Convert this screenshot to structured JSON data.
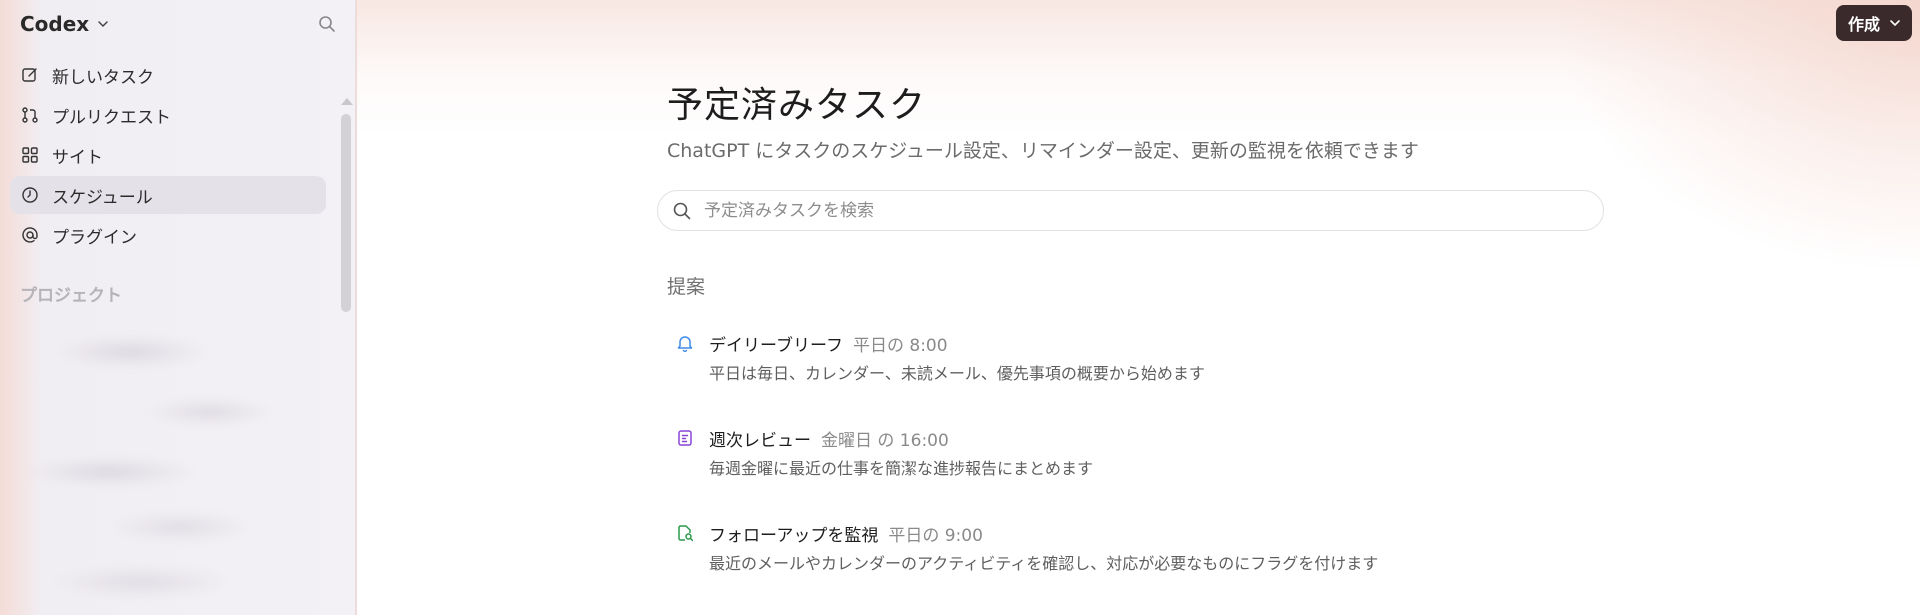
{
  "sidebar": {
    "app_title": "Codex",
    "nav": [
      {
        "label": "新しいタスク",
        "icon": "edit-icon"
      },
      {
        "label": "プルリクエスト",
        "icon": "pull-request-icon"
      },
      {
        "label": "サイト",
        "icon": "grid-icon"
      },
      {
        "label": "スケジュール",
        "icon": "clock-icon"
      },
      {
        "label": "プラグイン",
        "icon": "at-icon"
      }
    ],
    "active_item": "スケジュール",
    "projects_label": "プロジェクト"
  },
  "header": {
    "create_label": "作成"
  },
  "main": {
    "title": "予定済みタスク",
    "subtitle": "ChatGPT にタスクのスケジュール設定、リマインダー設定、更新の監視を依頼できます",
    "search_placeholder": "予定済みタスクを検索",
    "suggestions_label": "提案",
    "suggestions": [
      {
        "title": "デイリーブリーフ",
        "time": "平日の 8:00",
        "description": "平日は毎日、カレンダー、未読メール、優先事項の概要から始めます",
        "icon": "bell-icon",
        "color": "#3d8be6"
      },
      {
        "title": "週次レビュー",
        "time": "金曜日 の 16:00",
        "description": "毎週金曜に最近の仕事を簡潔な進捗報告にまとめます",
        "icon": "note-icon",
        "color": "#8a45d6"
      },
      {
        "title": "フォローアップを監視",
        "time": "平日の 9:00",
        "description": "最近のメールやカレンダーのアクティビティを確認し、対応が必要なものにフラグを付けます",
        "icon": "file-search-icon",
        "color": "#2a9a4a"
      }
    ]
  }
}
